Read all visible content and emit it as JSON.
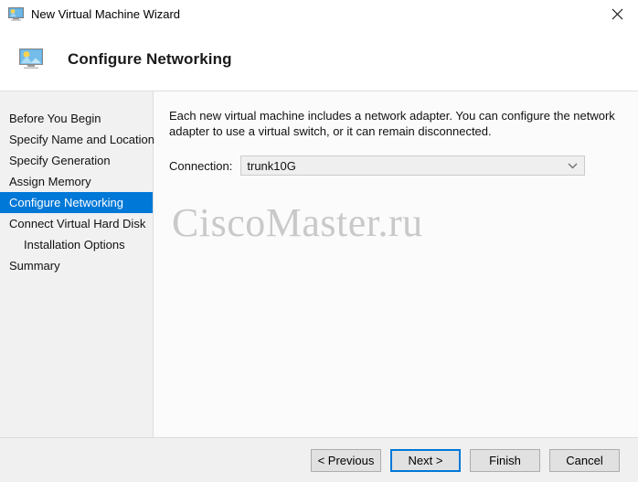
{
  "window": {
    "title": "New Virtual Machine Wizard",
    "title_icon": "virtual-machine-monitor-icon",
    "close_label": "✕"
  },
  "header": {
    "icon": "network-monitor-icon",
    "title": "Configure Networking"
  },
  "sidebar": {
    "items": [
      {
        "label": "Before You Begin",
        "selected": false,
        "sub": false
      },
      {
        "label": "Specify Name and Location",
        "selected": false,
        "sub": false
      },
      {
        "label": "Specify Generation",
        "selected": false,
        "sub": false
      },
      {
        "label": "Assign Memory",
        "selected": false,
        "sub": false
      },
      {
        "label": "Configure Networking",
        "selected": true,
        "sub": false
      },
      {
        "label": "Connect Virtual Hard Disk",
        "selected": false,
        "sub": false
      },
      {
        "label": "Installation Options",
        "selected": false,
        "sub": true
      },
      {
        "label": "Summary",
        "selected": false,
        "sub": false
      }
    ]
  },
  "main": {
    "description": "Each new virtual machine includes a network adapter. You can configure the network adapter to use a virtual switch, or it can remain disconnected.",
    "connection_label": "Connection:",
    "connection_value": "trunk10G",
    "connection_options": [
      "trunk10G"
    ],
    "watermark": "CiscoMaster.ru"
  },
  "footer": {
    "buttons": [
      {
        "label": "< Previous",
        "default": false
      },
      {
        "label": "Next >",
        "default": true
      },
      {
        "label": "Finish",
        "default": false
      },
      {
        "label": "Cancel",
        "default": false
      }
    ]
  },
  "colors": {
    "accent": "#0078d7",
    "sidebar_bg": "#f1f1f1",
    "footer_bg": "#f0f0f0",
    "watermark": "#c9c9c9"
  }
}
